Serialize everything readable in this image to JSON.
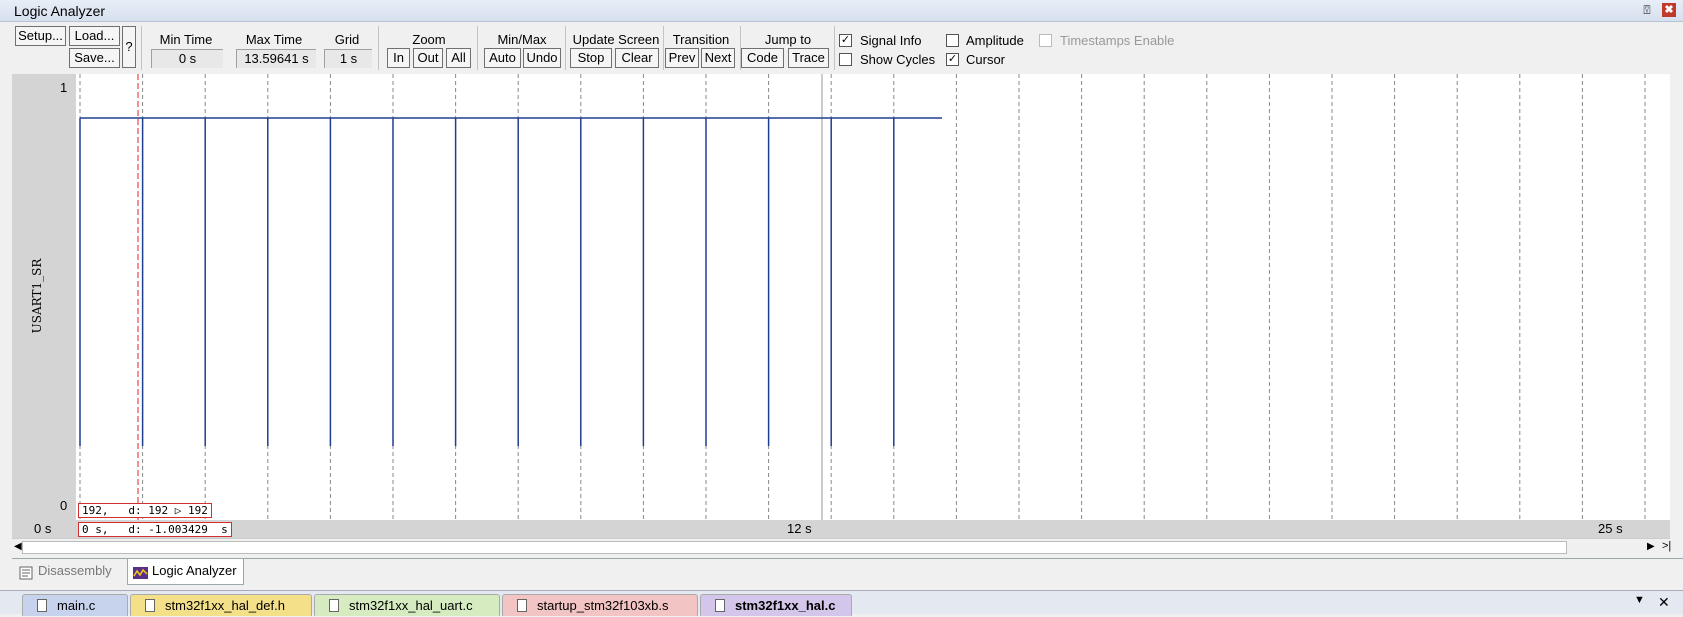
{
  "window": {
    "title": "Logic Analyzer",
    "pin_glyph": "⍔",
    "close_glyph": "✖"
  },
  "toolbar": {
    "setup": "Setup...",
    "load": "Load...",
    "save": "Save...",
    "help": "?",
    "min_time_label": "Min Time",
    "min_time_value": "0 s",
    "max_time_label": "Max Time",
    "max_time_value": "13.59641 s",
    "grid_label": "Grid",
    "grid_value": "1 s",
    "zoom_label": "Zoom",
    "zoom_in": "In",
    "zoom_out": "Out",
    "zoom_all": "All",
    "minmax_label": "Min/Max",
    "auto": "Auto",
    "undo": "Undo",
    "update_label": "Update Screen",
    "stop": "Stop",
    "clear": "Clear",
    "transition_label": "Transition",
    "prev": "Prev",
    "next": "Next",
    "jump_label": "Jump to",
    "code": "Code",
    "trace": "Trace",
    "signal_info": "Signal Info",
    "signal_info_checked": true,
    "amplitude": "Amplitude",
    "amplitude_checked": false,
    "timestamps": "Timestamps Enable",
    "timestamps_checked": false,
    "show_cycles": "Show Cycles",
    "show_cycles_checked": false,
    "cursor": "Cursor",
    "cursor_checked": true
  },
  "plot": {
    "signal_name": "USART1_SR",
    "y_max_label": "1",
    "y_min_label": "0",
    "time_start": "0 s",
    "time_mid": "12 s",
    "time_end": "25 s",
    "cursor_value": "192,   d: 192 ▷ 192",
    "cursor_time": "0 s,   d: -1.003429  s",
    "colors": {
      "signal": "#1f3f8f",
      "cursor": "#e02020",
      "grid": "#888888"
    }
  },
  "bottom_tabs": [
    {
      "label": "Disassembly",
      "icon": "disassembly-icon",
      "active": false
    },
    {
      "label": "Logic Analyzer",
      "icon": "logic-analyzer-icon",
      "active": true
    }
  ],
  "file_tabs": [
    {
      "label": "main.c",
      "color": "#c7d3ec"
    },
    {
      "label": "stm32f1xx_hal_def.h",
      "color": "#f5e08a"
    },
    {
      "label": "stm32f1xx_hal_uart.c",
      "color": "#d6ecc0"
    },
    {
      "label": "startup_stm32f103xb.s",
      "color": "#f2c4c4"
    },
    {
      "label": "stm32f1xx_hal.c",
      "color": "#d4c6ea"
    }
  ],
  "file_controls": {
    "dropdown": "▼",
    "close": "✕"
  }
}
